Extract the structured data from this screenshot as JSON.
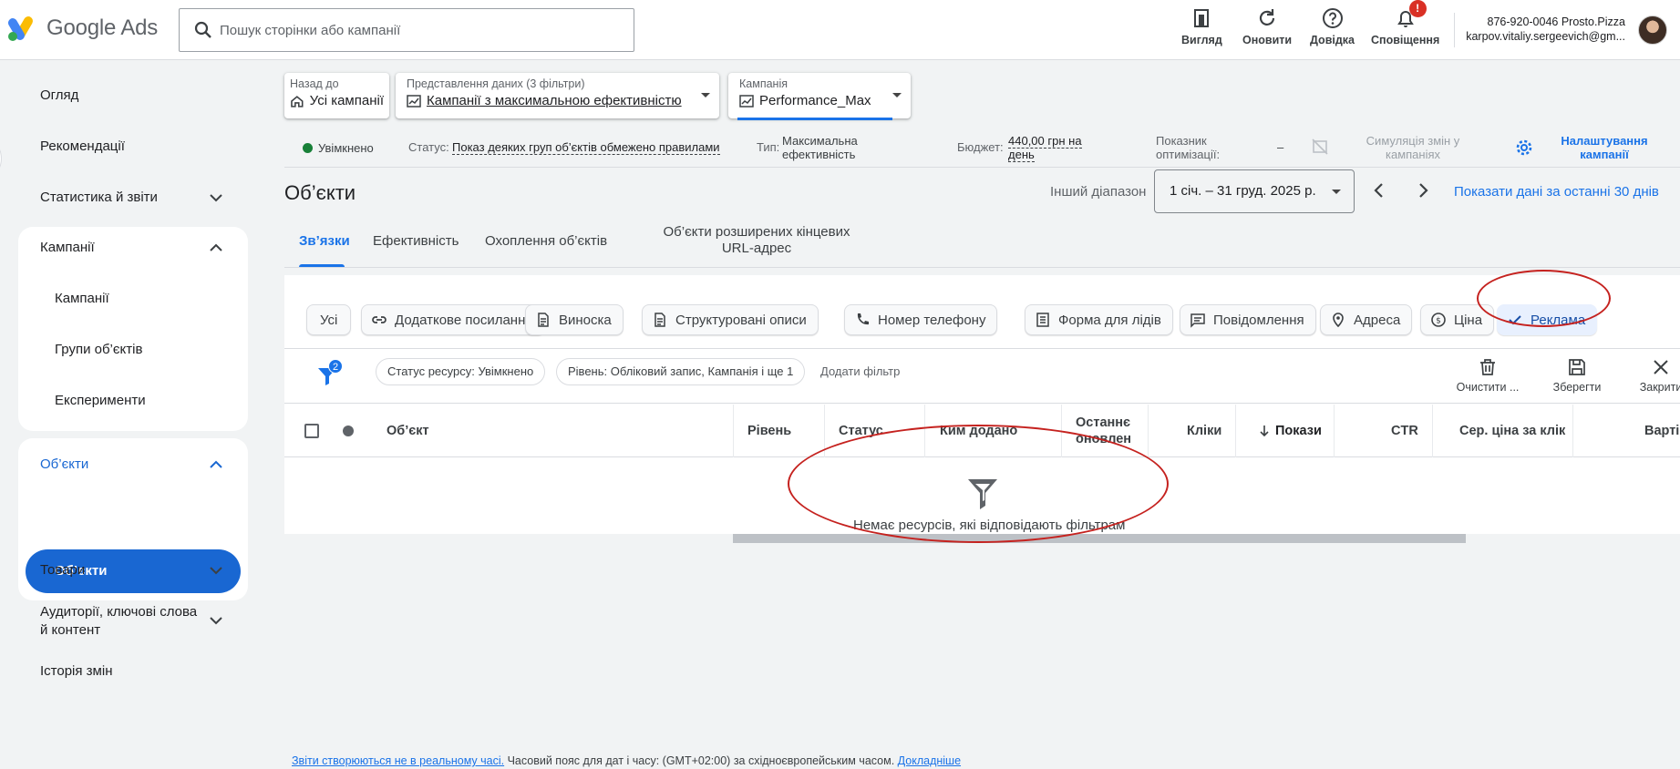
{
  "app": {
    "logo_text": "Google Ads",
    "search_placeholder": "Пошук сторінки або кампанії"
  },
  "toolbar": {
    "appearance": "Вигляд",
    "refresh": "Оновити",
    "help": "Довідка",
    "notifications": "Сповіщення",
    "notifications_badge": "!"
  },
  "account": {
    "line1": "876-920-0046 Prosto.Pizza",
    "line2": "karpov.vitaliy.sergeevich@gm..."
  },
  "nav": {
    "overview": "Огляд",
    "recommendations": "Рекомендації",
    "stats_reports": "Статистика й звіти",
    "campaigns_group": "Кампанії",
    "campaigns": "Кампанії",
    "asset_groups": "Групи об’єктів",
    "experiments": "Експерименти",
    "assets_group": "Об’єкти",
    "assets": "Об’єкти",
    "products": "Товари",
    "audiences": "Аудиторії, ключові слова й контент",
    "change_history": "Історія змін"
  },
  "header": {
    "back_label": "Назад до",
    "back_value": "Усі кампанії",
    "view_label": "Представлення даних (3 фільтри)",
    "view_value": "Кампанії з максимальною ефективністю",
    "campaign_label": "Кампанія",
    "campaign_value": "Performance_Max"
  },
  "status_row": {
    "enabled": "Увімкнено",
    "status_label": "Статус:",
    "status_value": "Показ деяких груп об’єктів обмежено правилами",
    "type_label": "Тип:",
    "type_value_1": "Максимальна",
    "type_value_2": "ефективність",
    "budget_label": "Бюджет:",
    "budget_value_1": "440,00 грн на",
    "budget_value_2": "день",
    "opt_label_1": "Показник",
    "opt_label_2": "оптимізації:",
    "opt_value": "–",
    "simulate_1": "Симуляція змін у",
    "simulate_2": "кампаніях",
    "settings_1": "Налаштування",
    "settings_2": "кампанії"
  },
  "page": {
    "title": "Об’єкти",
    "range_label": "Інший діапазон",
    "range_value": "1 січ. – 31 груд. 2025 р.",
    "last30": "Показати дані за останні 30 днів"
  },
  "tabs": [
    "Зв’язки",
    "Ефективність",
    "Охоплення об’єктів",
    "Об’єкти розширених кінцевих",
    "URL-адрес"
  ],
  "chips": [
    "Усі",
    "Додаткове посилання",
    "Виноска",
    "Структуровані описи",
    "Номер телефону",
    "Форма для лідів",
    "Повідомлення",
    "Адреса",
    "Ціна",
    "Реклама"
  ],
  "filters": {
    "count": "2",
    "chip1": "Статус ресурсу: Увімкнено",
    "chip2": "Рівень: Обліковий запис, Кампанія і ще 1",
    "add": "Додати фільтр",
    "clear": "Очистити ...",
    "save": "Зберегти",
    "close": "Закрити"
  },
  "table": {
    "col_asset": "Об’єкт",
    "col_level": "Рівень",
    "col_status": "Статус",
    "col_added_by": "Ким додано",
    "col_updated_1": "Останнє",
    "col_updated_2": "оновлен",
    "col_clicks": "Кліки",
    "col_impr": "Покази",
    "col_ctr": "CTR",
    "col_cpc": "Сер. ціна за клік",
    "col_cost": "Вартіс",
    "empty": "Немає ресурсів, які відповідають фільтрам"
  },
  "footer": {
    "link1": "Звіти створюються не в реальному часі.",
    "text": " Часовий пояс для дат і часу: (GMT+02:00) за східноєвропейським часом. ",
    "link2": "Докладніше"
  },
  "colors": {
    "accent": "#1a73e8",
    "nav_active": "#1967d2",
    "enabled_green": "#188038",
    "annotation_red": "#c5221f"
  }
}
